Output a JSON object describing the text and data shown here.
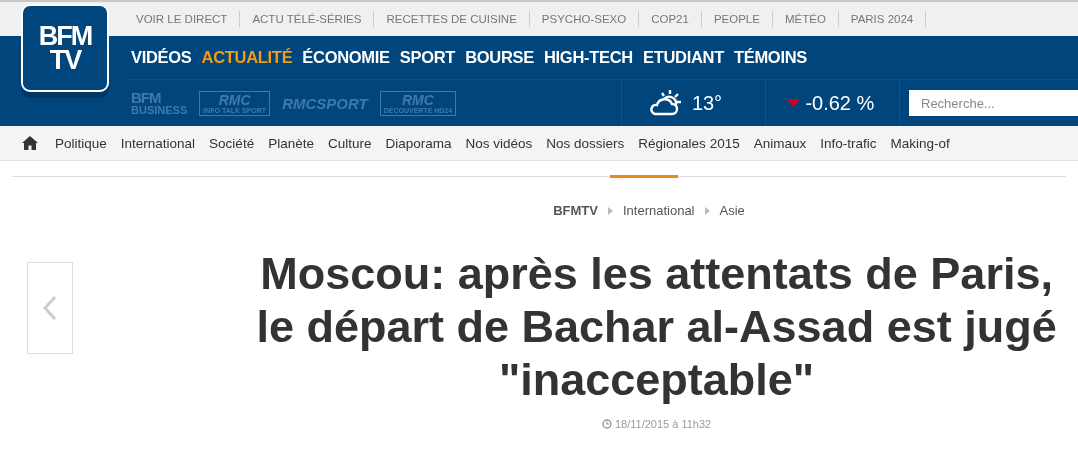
{
  "logo": {
    "line_1": "BFM",
    "line_2": "TV"
  },
  "top_links": [
    "VOIR LE DIRECT",
    "ACTU TÉLÉ-SÉRIES",
    "RECETTES DE CUISINE",
    "PSYCHO-SEXO",
    "COP21",
    "PEOPLE",
    "MÉTÉO",
    "PARIS 2024"
  ],
  "main_nav": [
    {
      "label": "VIDÉOS",
      "selected": false
    },
    {
      "label": "ACTUALITÉ",
      "selected": true
    },
    {
      "label": "ÉCONOMIE",
      "selected": false
    },
    {
      "label": "SPORT",
      "selected": false
    },
    {
      "label": "BOURSE",
      "selected": false
    },
    {
      "label": "HIGH-TECH",
      "selected": false
    },
    {
      "label": "ETUDIANT",
      "selected": false
    },
    {
      "label": "TÉMOINS",
      "selected": false
    }
  ],
  "channels": [
    {
      "kind": "stacked",
      "lines": [
        "BFM",
        "BUSINESS"
      ]
    },
    {
      "kind": "boxed",
      "lines": [
        "RMC",
        "INFO TALK SPORT"
      ]
    },
    {
      "kind": "italic",
      "lines": [
        "RMCSPORT"
      ]
    },
    {
      "kind": "boxed",
      "lines": [
        "RMC",
        "DECOUVERTE HD24"
      ]
    }
  ],
  "weather": {
    "temperature": "13°"
  },
  "market": {
    "kind": "down",
    "change": "-0.62 %"
  },
  "search": {
    "placeholder": "Recherche..."
  },
  "categories": [
    "Politique",
    "International",
    "Société",
    "Planète",
    "Culture",
    "Diaporama",
    "Nos vidéos",
    "Nos dossiers",
    "Régionales 2015",
    "Animaux",
    "Info-trafic",
    "Making-of"
  ],
  "breadcrumb": [
    "BFMTV",
    "International",
    "Asie"
  ],
  "article": {
    "title": "Moscou: après les attentats de Paris, le départ de Bachar al-Assad est jugé \"inacceptable\"",
    "date": "18/11/2015 à 11h32"
  }
}
